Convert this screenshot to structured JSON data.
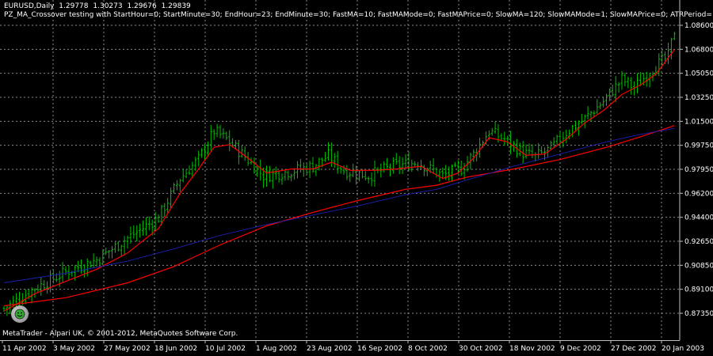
{
  "header": {
    "symbol": "EURUSD,Daily",
    "ohlc": [
      "1.29778",
      "1.30273",
      "1.29676",
      "1.29839"
    ],
    "params": "PZ_MA_Crossover testing with StartHour=0; StartMinute=30; EndHour=23; EndMinute=30; FastMA=10; FastMAMode=0; FastMAPrice=0; SlowMA=120; SlowMAMode=1; SlowMAPrice=0; ATRPeriod="
  },
  "footer": {
    "copyright": "MetaTrader - Alpari UK, © 2001-2012, MetaQuotes Software Corp."
  },
  "expert_icon": "smiley-expert-icon",
  "colors": {
    "background": "#000000",
    "grid": "#8a8a8a",
    "candles": "#00c000",
    "fast_ma": "#ff0000",
    "slow_ma": "#1e1eb4",
    "text": "#ffffff"
  },
  "chart_data": {
    "type": "candlestick",
    "y_ticks": [
      "1.08600",
      "1.06800",
      "1.05050",
      "1.03250",
      "1.01500",
      "0.99750",
      "0.97950",
      "0.96200",
      "0.94400",
      "0.92650",
      "0.90850",
      "0.89100",
      "0.87350"
    ],
    "ylim": [
      0.8735,
      1.086
    ],
    "x_ticks": [
      "11 Apr 2002",
      "3 May 2002",
      "27 May 2002",
      "18 Jun 2002",
      "10 Jul 2002",
      "1 Aug 2002",
      "23 Aug 2002",
      "16 Sep 2002",
      "8 Oct 2002",
      "30 Oct 2002",
      "18 Nov 2002",
      "9 Dec 2002",
      "27 Dec 2002",
      "20 Jan 2003"
    ],
    "grid": true,
    "close_trend": [
      [
        0,
        0.877
      ],
      [
        10,
        0.892
      ],
      [
        20,
        0.904
      ],
      [
        30,
        0.913
      ],
      [
        40,
        0.929
      ],
      [
        50,
        0.944
      ],
      [
        57,
        0.973
      ],
      [
        63,
        0.987
      ],
      [
        68,
        1.008
      ],
      [
        72,
        1.002
      ],
      [
        78,
        0.989
      ],
      [
        84,
        0.975
      ],
      [
        92,
        0.978
      ],
      [
        100,
        0.982
      ],
      [
        105,
        0.99
      ],
      [
        110,
        0.979
      ],
      [
        118,
        0.975
      ],
      [
        126,
        0.982
      ],
      [
        134,
        0.985
      ],
      [
        142,
        0.975
      ],
      [
        148,
        0.98
      ],
      [
        152,
        0.991
      ],
      [
        157,
        1.008
      ],
      [
        162,
        1.002
      ],
      [
        168,
        0.992
      ],
      [
        172,
        0.989
      ],
      [
        177,
        0.995
      ],
      [
        182,
        1.007
      ],
      [
        188,
        1.017
      ],
      [
        194,
        1.03
      ],
      [
        200,
        1.046
      ],
      [
        204,
        1.04
      ],
      [
        210,
        1.054
      ],
      [
        215,
        1.063
      ],
      [
        217,
        1.082
      ]
    ],
    "series": [
      {
        "name": "FastMA=10",
        "values": [
          [
            0,
            0.875
          ],
          [
            10,
            0.888
          ],
          [
            20,
            0.897
          ],
          [
            30,
            0.906
          ],
          [
            40,
            0.918
          ],
          [
            50,
            0.936
          ],
          [
            57,
            0.962
          ],
          [
            63,
            0.98
          ],
          [
            68,
            0.996
          ],
          [
            73,
            0.998
          ],
          [
            79,
            0.988
          ],
          [
            85,
            0.977
          ],
          [
            93,
            0.98
          ],
          [
            100,
            0.98
          ],
          [
            106,
            0.985
          ],
          [
            112,
            0.979
          ],
          [
            120,
            0.979
          ],
          [
            127,
            0.98
          ],
          [
            135,
            0.982
          ],
          [
            142,
            0.973
          ],
          [
            147,
            0.977
          ],
          [
            152,
            0.988
          ],
          [
            157,
            1.003
          ],
          [
            163,
            1.0
          ],
          [
            169,
            0.99
          ],
          [
            175,
            0.991
          ],
          [
            182,
            1.002
          ],
          [
            188,
            1.014
          ],
          [
            194,
            1.023
          ],
          [
            200,
            1.035
          ],
          [
            206,
            1.042
          ],
          [
            211,
            1.05
          ],
          [
            217,
            1.068
          ]
        ]
      },
      {
        "name": "SlowMA=120",
        "values": [
          [
            0,
            0.879
          ],
          [
            20,
            0.885
          ],
          [
            40,
            0.896
          ],
          [
            55,
            0.908
          ],
          [
            70,
            0.924
          ],
          [
            85,
            0.938
          ],
          [
            100,
            0.948
          ],
          [
            115,
            0.957
          ],
          [
            130,
            0.965
          ],
          [
            140,
            0.968
          ],
          [
            150,
            0.974
          ],
          [
            165,
            0.98
          ],
          [
            180,
            0.987
          ],
          [
            195,
            0.996
          ],
          [
            205,
            1.003
          ],
          [
            217,
            1.012
          ]
        ]
      },
      {
        "name": "",
        "values": [
          [
            0,
            0.896
          ],
          [
            20,
            0.903
          ],
          [
            40,
            0.912
          ],
          [
            55,
            0.921
          ],
          [
            70,
            0.931
          ],
          [
            85,
            0.939
          ],
          [
            100,
            0.946
          ],
          [
            115,
            0.953
          ],
          [
            130,
            0.961
          ],
          [
            140,
            0.965
          ],
          [
            150,
            0.972
          ],
          [
            165,
            0.982
          ],
          [
            180,
            0.991
          ],
          [
            195,
            1.0
          ],
          [
            205,
            1.005
          ],
          [
            217,
            1.01
          ]
        ]
      }
    ]
  }
}
